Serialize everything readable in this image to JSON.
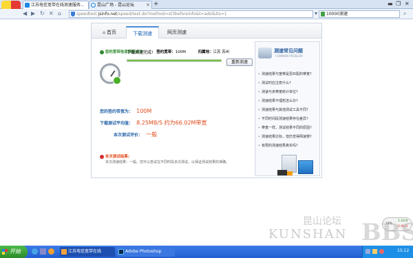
{
  "browser": {
    "tabs": [
      {
        "label": "江苏电信宽带在线测速服务...",
        "active": true
      },
      {
        "label": "昆山广场 - 昆山论坛",
        "active": false
      }
    ],
    "new_tab_label": "+",
    "tab_close": "×",
    "window_controls": [
      "▬",
      "❐",
      "✕"
    ],
    "url_domain": "speedtest.jsinfo.net",
    "url_prefix": "speedtest.",
    "url_host": "jsinfo.net",
    "url_path": "/speed/test.do?method=st3beforeinfo&t=adsl&its=1",
    "search_value": "10000测速"
  },
  "page": {
    "tabs": [
      {
        "label": "首页",
        "active": false
      },
      {
        "label": "下载测速",
        "active": true
      },
      {
        "label": "网页测速",
        "active": false
      }
    ],
    "info": {
      "success_text": "您的宽带信息获取成功",
      "contract_label": "签约宽带：",
      "contract_value": "100M",
      "home_label": "归属地：",
      "home_value": "江苏 苏州"
    },
    "test": {
      "status_text": "下载测速完成!",
      "progress": 1.0,
      "retest_label": "重新测速"
    },
    "results": {
      "contract_label": "您的签约带宽为：",
      "contract_value": "100M",
      "avg_label": "下载测试平均值：",
      "avg_value": "8.25MB/S 约为66.02M带宽",
      "rating_label": "本次测试评价：",
      "rating_value": "一般"
    },
    "conclusion": {
      "title": "本次测试结果:",
      "text": "本次测速结果：一般。您可以尝试在不同时段多次测试，以保证测试结果的准确。"
    },
    "faq": {
      "title": "测速常见问题",
      "subtitle": "COMMON PROBLEM",
      "items": [
        "测速结果与宽带是否匹配的带宽?",
        "测试时应注意什么?",
        "测速与夹带宽统计单位?",
        "测速结果不理想怎么办?",
        "测速结果与其他测试工具不同?",
        "不同时间段测速结果存在差异?",
        "带宽一样，测试结果不同的原因?",
        "测速结果达标，但仍觉得网速慢?",
        "有限的测速结果真实吗?"
      ]
    }
  },
  "taskbar": {
    "start_label": "开始",
    "items": [
      "江苏电信宽带在线",
      "Adobe Photoshop"
    ],
    "tray_stats": [
      "1.1K/S",
      "0.9K/S"
    ],
    "tray_percent": "18%",
    "clock": "15:12"
  },
  "watermark": {
    "line1": "昆山论坛",
    "line2": "KUNSHAN",
    "line3": "BBS"
  },
  "colors": {
    "accent": "#4a8bd8",
    "success": "#2e8b2e",
    "result": "#e04b1a",
    "taskbar": "#245fd0",
    "start": "#2c8c29"
  }
}
